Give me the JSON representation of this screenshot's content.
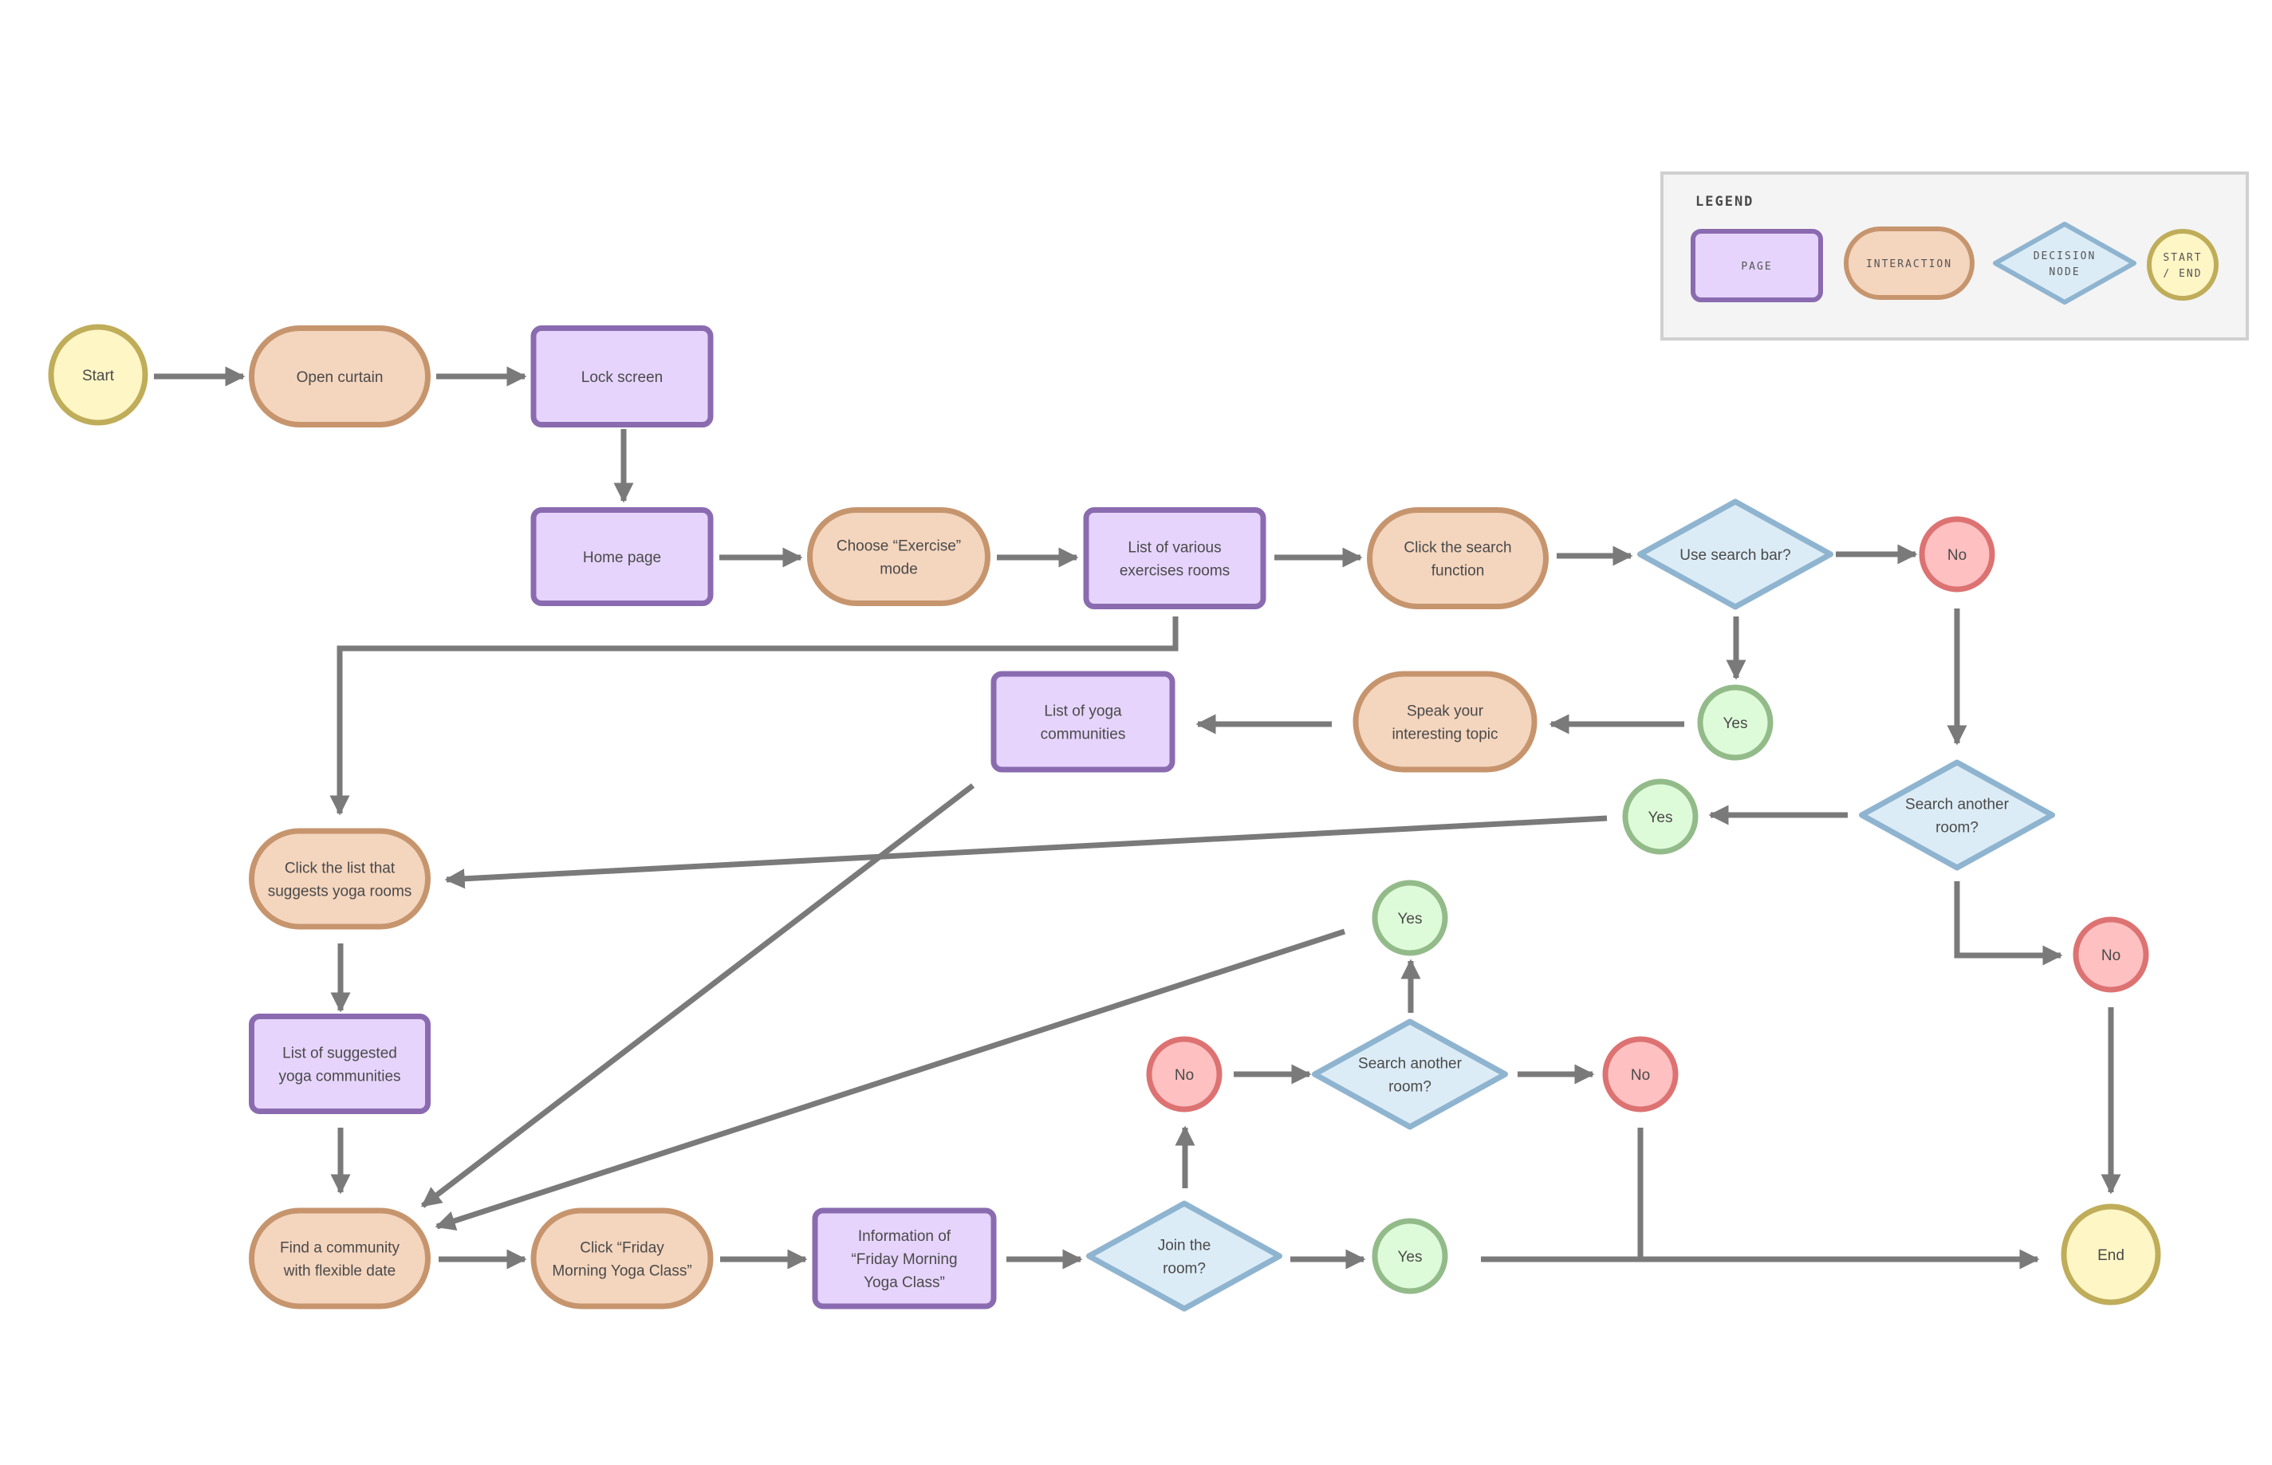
{
  "legend": {
    "title": "Legend",
    "items": [
      {
        "kind": "page",
        "label": "Page"
      },
      {
        "kind": "interaction",
        "label": "Interaction"
      },
      {
        "kind": "decision",
        "label": "Decision Node",
        "lines": [
          "Decision",
          "Node"
        ]
      },
      {
        "kind": "terminal",
        "label": "Start / End",
        "lines": [
          "START",
          "/ END"
        ]
      }
    ]
  },
  "colors": {
    "page_fill": "#e6d4fc",
    "page_stroke": "#8a6bb0",
    "interaction_fill": "#f4d5be",
    "interaction_stroke": "#c6956e",
    "decision_fill": "#dcecf6",
    "decision_stroke": "#8fb4d0",
    "terminal_fill": "#fff6c6",
    "terminal_stroke": "#bfad5a",
    "yes_fill": "#defbd9",
    "yes_stroke": "#93bb8a",
    "no_fill": "#fec0c0",
    "no_stroke": "#dd7272",
    "edge": "#7a7a7a",
    "legend_bg": "#f4f4f4",
    "legend_border": "#d0d0d0"
  },
  "nodes": [
    {
      "id": "start",
      "kind": "terminal",
      "lines": [
        "Start"
      ]
    },
    {
      "id": "open-curtain",
      "kind": "interaction",
      "lines": [
        "Open curtain"
      ]
    },
    {
      "id": "lock-screen",
      "kind": "page",
      "lines": [
        "Lock screen"
      ]
    },
    {
      "id": "home-page",
      "kind": "page",
      "lines": [
        "Home page"
      ]
    },
    {
      "id": "choose-exercise",
      "kind": "interaction",
      "lines": [
        "Choose “Exercise”",
        "mode"
      ]
    },
    {
      "id": "list-exercise-rooms",
      "kind": "page",
      "lines": [
        "List of various",
        "exercises rooms"
      ]
    },
    {
      "id": "click-search",
      "kind": "interaction",
      "lines": [
        "Click the search",
        "function"
      ]
    },
    {
      "id": "use-search-bar",
      "kind": "decision",
      "lines": [
        "Use search bar?"
      ]
    },
    {
      "id": "no-1",
      "kind": "no",
      "lines": [
        "No"
      ]
    },
    {
      "id": "yes-1",
      "kind": "yes",
      "lines": [
        "Yes"
      ]
    },
    {
      "id": "speak-topic",
      "kind": "interaction",
      "lines": [
        "Speak your",
        "interesting topic"
      ]
    },
    {
      "id": "list-yoga-communities",
      "kind": "page",
      "lines": [
        "List of yoga",
        "communities"
      ]
    },
    {
      "id": "search-another-1",
      "kind": "decision",
      "lines": [
        "Search another",
        "room?"
      ]
    },
    {
      "id": "yes-2",
      "kind": "yes",
      "lines": [
        "Yes"
      ]
    },
    {
      "id": "no-2",
      "kind": "no",
      "lines": [
        "No"
      ]
    },
    {
      "id": "end",
      "kind": "terminal",
      "lines": [
        "End"
      ]
    },
    {
      "id": "click-yoga-list",
      "kind": "interaction",
      "lines": [
        "Click the list that",
        "suggests yoga rooms"
      ]
    },
    {
      "id": "list-suggested",
      "kind": "page",
      "lines": [
        "List of suggested",
        "yoga communities"
      ]
    },
    {
      "id": "find-community",
      "kind": "interaction",
      "lines": [
        "Find a community",
        "with flexible date"
      ]
    },
    {
      "id": "click-friday",
      "kind": "interaction",
      "lines": [
        "Click “Friday",
        "Morning Yoga Class”"
      ]
    },
    {
      "id": "info-friday",
      "kind": "page",
      "lines": [
        "Information of",
        "“Friday Morning",
        "Yoga Class”"
      ]
    },
    {
      "id": "join-room",
      "kind": "decision",
      "lines": [
        "Join the",
        "room?"
      ]
    },
    {
      "id": "yes-3",
      "kind": "yes",
      "lines": [
        "Yes"
      ]
    },
    {
      "id": "no-3",
      "kind": "no",
      "lines": [
        "No"
      ]
    },
    {
      "id": "search-another-2",
      "kind": "decision",
      "lines": [
        "Search another",
        "room?"
      ]
    },
    {
      "id": "no-4",
      "kind": "no",
      "lines": [
        "No"
      ]
    },
    {
      "id": "yes-4",
      "kind": "yes",
      "lines": [
        "Yes"
      ]
    }
  ],
  "edges": [
    {
      "from": "start",
      "to": "open-curtain"
    },
    {
      "from": "open-curtain",
      "to": "lock-screen"
    },
    {
      "from": "lock-screen",
      "to": "home-page"
    },
    {
      "from": "home-page",
      "to": "choose-exercise"
    },
    {
      "from": "choose-exercise",
      "to": "list-exercise-rooms"
    },
    {
      "from": "list-exercise-rooms",
      "to": "click-search"
    },
    {
      "from": "list-exercise-rooms",
      "to": "click-yoga-list"
    },
    {
      "from": "click-search",
      "to": "use-search-bar"
    },
    {
      "from": "use-search-bar",
      "to": "no-1"
    },
    {
      "from": "use-search-bar",
      "to": "yes-1"
    },
    {
      "from": "yes-1",
      "to": "speak-topic"
    },
    {
      "from": "speak-topic",
      "to": "list-yoga-communities"
    },
    {
      "from": "list-yoga-communities",
      "to": "find-community"
    },
    {
      "from": "no-1",
      "to": "search-another-1"
    },
    {
      "from": "search-another-1",
      "to": "yes-2"
    },
    {
      "from": "search-another-1",
      "to": "no-2"
    },
    {
      "from": "yes-2",
      "to": "click-yoga-list"
    },
    {
      "from": "no-2",
      "to": "end"
    },
    {
      "from": "click-yoga-list",
      "to": "list-suggested"
    },
    {
      "from": "list-suggested",
      "to": "find-community"
    },
    {
      "from": "find-community",
      "to": "click-friday"
    },
    {
      "from": "click-friday",
      "to": "info-friday"
    },
    {
      "from": "info-friday",
      "to": "join-room"
    },
    {
      "from": "join-room",
      "to": "yes-3"
    },
    {
      "from": "join-room",
      "to": "no-3"
    },
    {
      "from": "no-3",
      "to": "search-another-2"
    },
    {
      "from": "search-another-2",
      "to": "yes-4"
    },
    {
      "from": "search-another-2",
      "to": "no-4"
    },
    {
      "from": "yes-4",
      "to": "find-community"
    },
    {
      "from": "yes-3",
      "to": "end"
    },
    {
      "from": "no-4",
      "to": "end"
    }
  ]
}
